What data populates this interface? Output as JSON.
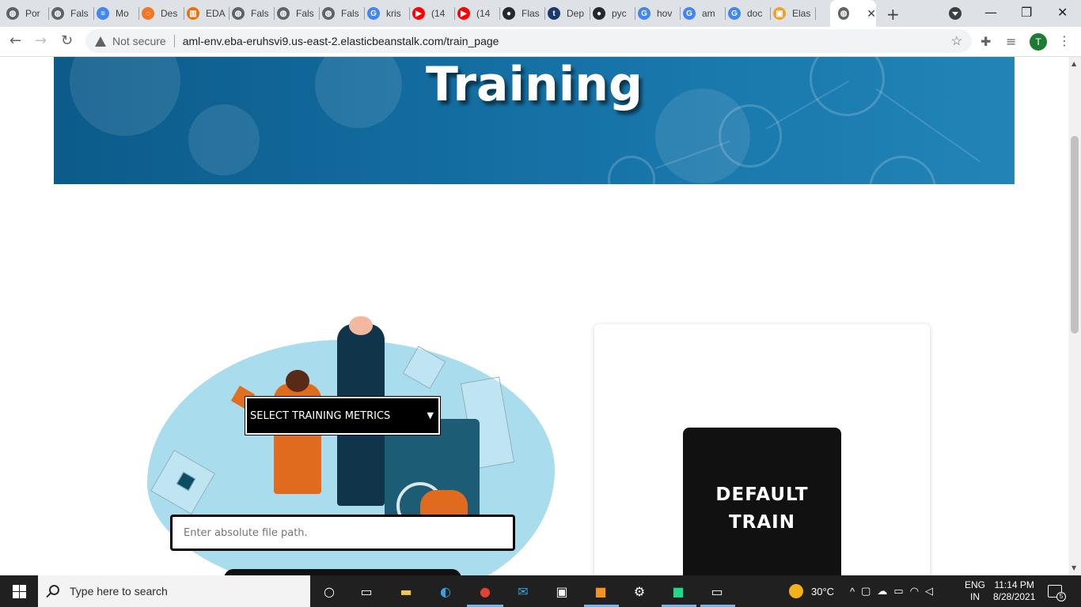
{
  "browser": {
    "tabs": [
      {
        "label": "Por",
        "icon": "globe-icon",
        "color": "#5f6368"
      },
      {
        "label": "Fals",
        "icon": "globe-icon",
        "color": "#5f6368"
      },
      {
        "label": "Mo",
        "icon": "docs-icon",
        "color": "#4285f4"
      },
      {
        "label": "Des",
        "icon": "jupyter-icon",
        "color": "#f37626"
      },
      {
        "label": "EDA",
        "icon": "notebook-icon",
        "color": "#e8710a"
      },
      {
        "label": "Fals",
        "icon": "globe-icon",
        "color": "#5f6368"
      },
      {
        "label": "Fals",
        "icon": "globe-icon",
        "color": "#5f6368"
      },
      {
        "label": "Fals",
        "icon": "globe-icon",
        "color": "#5f6368"
      },
      {
        "label": "kris",
        "icon": "google-icon",
        "color": "#4285f4"
      },
      {
        "label": "(14",
        "icon": "youtube-icon",
        "color": "#ff0000"
      },
      {
        "label": "(14",
        "icon": "youtube-icon",
        "color": "#ff0000"
      },
      {
        "label": "Flas",
        "icon": "github-icon",
        "color": "#24292e"
      },
      {
        "label": "Dep",
        "icon": "tds-icon",
        "color": "#1a3a6b"
      },
      {
        "label": "pyc",
        "icon": "github-icon",
        "color": "#24292e"
      },
      {
        "label": "hov",
        "icon": "google-icon",
        "color": "#4285f4"
      },
      {
        "label": "am",
        "icon": "google-icon",
        "color": "#4285f4"
      },
      {
        "label": "doc",
        "icon": "google-icon",
        "color": "#4285f4"
      },
      {
        "label": "Elas",
        "icon": "aws-box-icon",
        "color": "#f0a028"
      }
    ],
    "active_tab_close": "✕",
    "new_tab": "+",
    "window_controls": {
      "minimize": "—",
      "restore": "❐",
      "close": "✕"
    },
    "not_secure": "Not secure",
    "url": "aml-env.eba-eruhsvi9.us-east-2.elasticbeanstalk.com/train_page",
    "profile_initial": "T"
  },
  "page": {
    "hero_title": "Training",
    "select": {
      "label": "SELECT TRAINING METRICS"
    },
    "path_input": {
      "placeholder": "Enter absolute file path."
    },
    "default_train_label_1": "DEFAULT",
    "default_train_label_2": "TRAIN"
  },
  "taskbar": {
    "search_placeholder": "Type here to search",
    "weather": "30°C",
    "language_1": "ENG",
    "language_2": "IN",
    "time": "11:14 PM",
    "date": "8/28/2021",
    "notifications": "5"
  }
}
